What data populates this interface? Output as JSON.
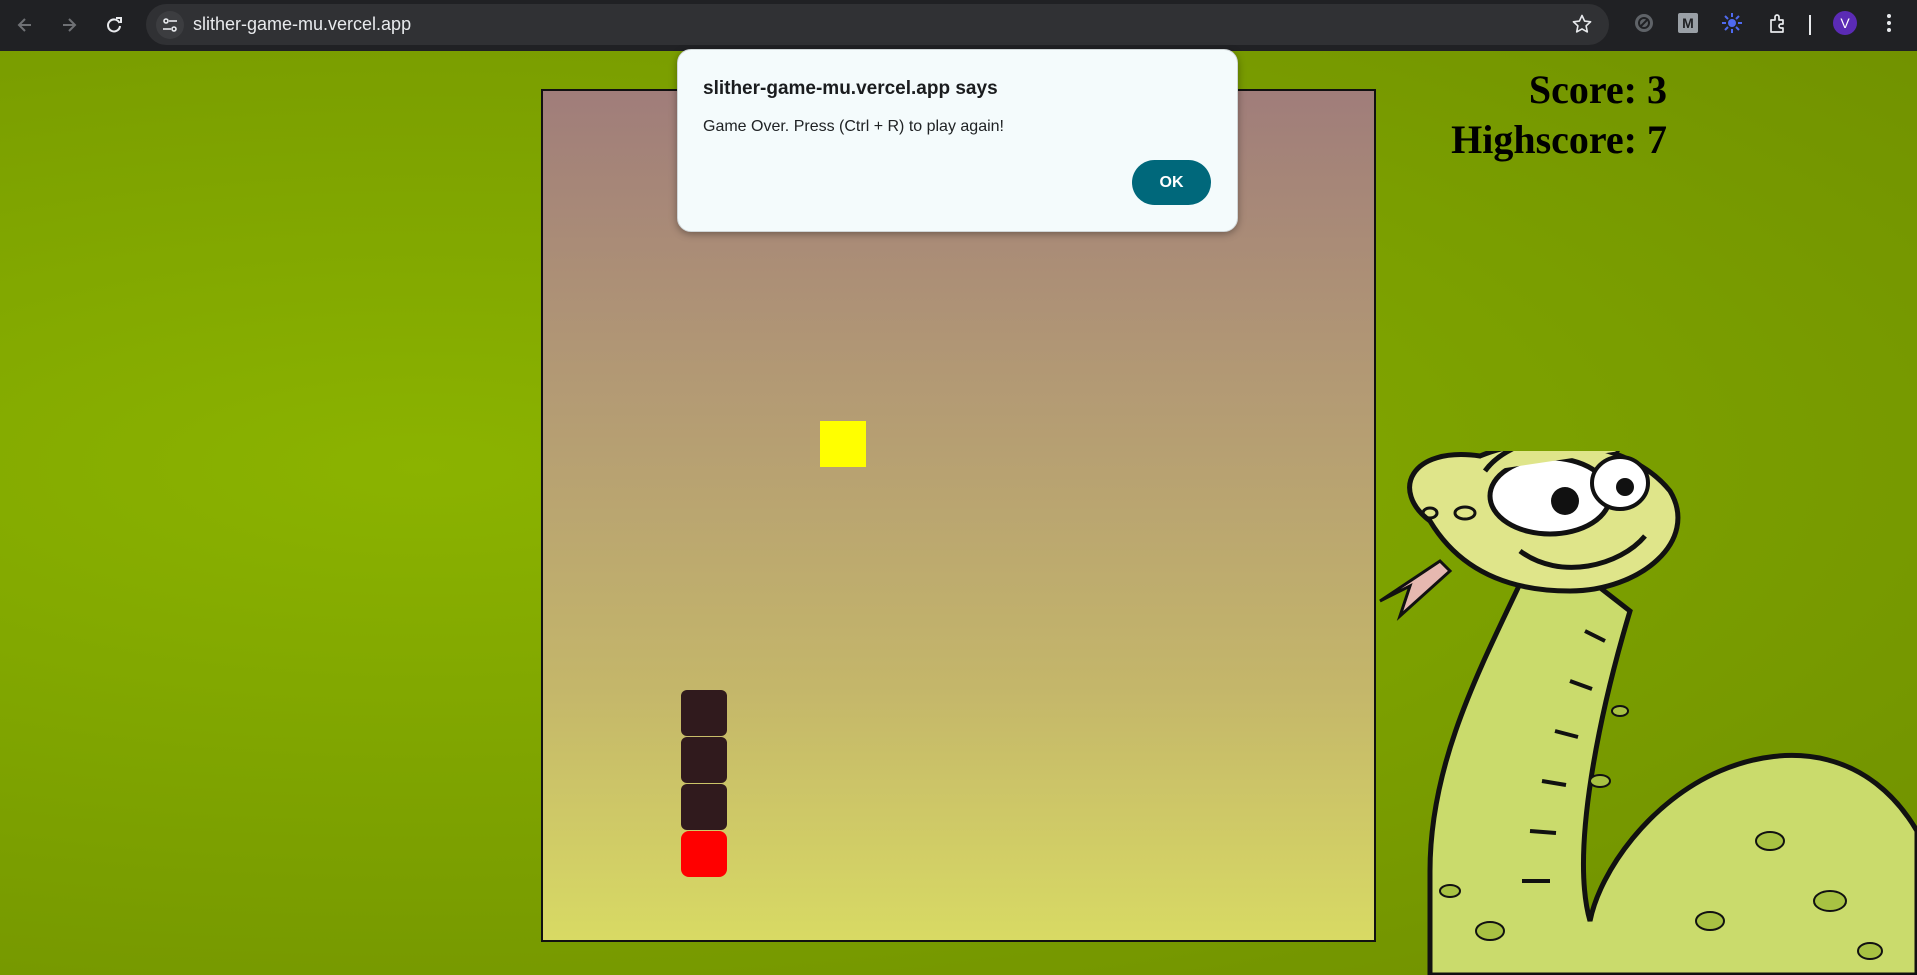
{
  "browser": {
    "url": "slither-game-mu.vercel.app",
    "profile_initial": "V",
    "extension_m_label": "M",
    "icons": [
      "back-icon",
      "forward-icon",
      "reload-icon",
      "site-info-icon",
      "bookmark-star-icon",
      "extension-icon",
      "menu-icon"
    ]
  },
  "game": {
    "score_text": "Score: 3",
    "highscore_text": "Highscore: 7",
    "score": 3,
    "highscore": 7
  },
  "dialog": {
    "title": "slither-game-mu.vercel.app says",
    "message": "Game Over. Press (Ctrl + R) to play again!",
    "ok_label": "OK"
  },
  "colors": {
    "page_background": "#7ea300",
    "snake_body": "#301a1d",
    "snake_head": "#ff0000",
    "food": "#ffff00",
    "ok_button": "#00687b"
  }
}
